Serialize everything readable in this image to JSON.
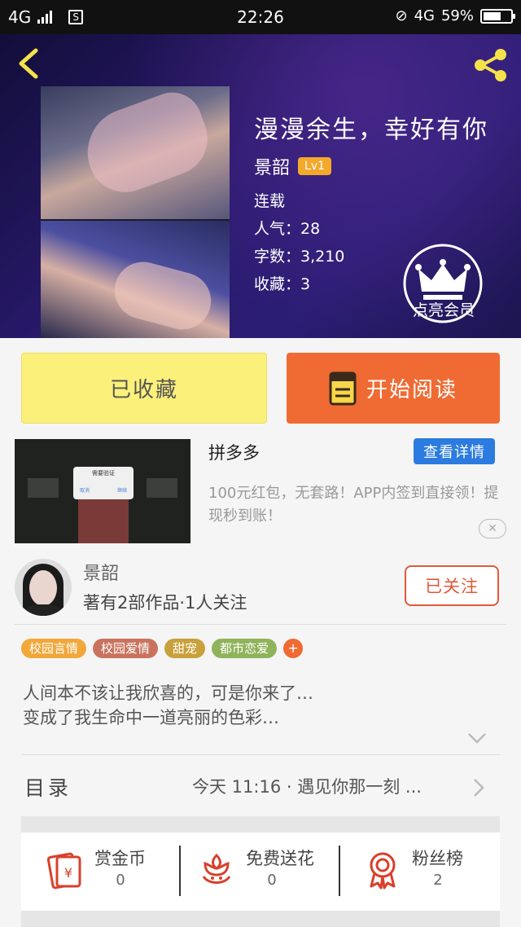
{
  "status_bar": {
    "network_left": "4G",
    "sim_icon": "S",
    "time": "22:26",
    "network_right": "4G",
    "battery": "59%"
  },
  "book": {
    "title": "漫漫余生，幸好有你",
    "author": "景韶",
    "level": "Lv1",
    "status": "连载",
    "popularity": "人气：28",
    "word_count": "字数：3,210",
    "favorites": "收藏：3",
    "vip_label": "点亮会员"
  },
  "actions": {
    "favorited": "已收藏",
    "start_reading": "开始阅读"
  },
  "ad": {
    "popup_title": "需要验证",
    "popup_cancel": "取消",
    "popup_confirm": "继续",
    "title": "拼多多",
    "detail_button": "查看详情",
    "description": "100元红包，无套路！APP内签到直接领！提现秒到账！",
    "close": "✕"
  },
  "author_section": {
    "name": "景韶",
    "works": "著有2部作品·1人关注",
    "follow": "已关注"
  },
  "tags": [
    {
      "label": "校园言情",
      "color": "#f1a73a"
    },
    {
      "label": "校园爱情",
      "color": "#c9735e"
    },
    {
      "label": "甜宠",
      "color": "#c9a13c"
    },
    {
      "label": "都市恋爱",
      "color": "#8fb35a"
    }
  ],
  "tag_more": "+",
  "intro": {
    "line1": "人间本不该让我欣喜的，可是你来了…",
    "line2": "变成了我生命中一道亮丽的色彩…"
  },
  "toc": {
    "label": "目录",
    "latest": "今天 11:16 · 遇见你那一刻 ..."
  },
  "bottom": {
    "reward": {
      "title": "赏金币",
      "count": "0"
    },
    "flower": {
      "title": "免费送花",
      "count": "0"
    },
    "fans": {
      "title": "粉丝榜",
      "count": "2"
    }
  },
  "colors": {
    "accent_orange": "#ef6b33",
    "favorite_yellow": "#fbf079",
    "link_blue": "#2b7be0",
    "follow_red": "#e05a3a",
    "icon_red": "#d9402a"
  }
}
